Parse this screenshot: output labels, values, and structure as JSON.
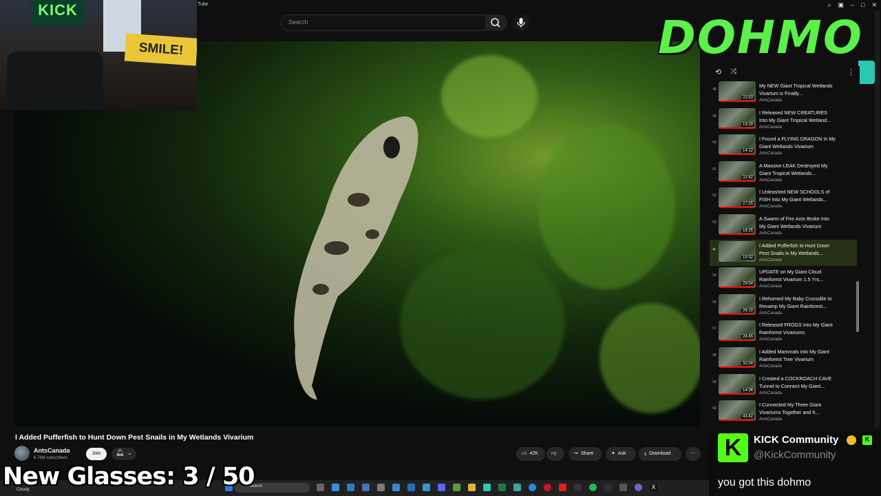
{
  "browser": {
    "tab_title": "Tube",
    "window_controls": [
      "zoom-icon",
      "screenshot-icon",
      "minimize-icon",
      "maximize-icon",
      "close-icon"
    ]
  },
  "search": {
    "placeholder": "Search"
  },
  "webcam_overlay": {
    "sign_kick": "KICK",
    "sign_smile": "SMILE!"
  },
  "logo": {
    "text": "DOHMO"
  },
  "playlist": {
    "items": [
      {
        "num": "48",
        "title": "My NEW Giant Tropical Wetlands Vivarium is Finally...",
        "channel": "AntsCanada",
        "duration": "22:53",
        "progress": 1.0,
        "current": false
      },
      {
        "num": "49",
        "title": "I Released NEW CREATURES Into My Giant Tropical Wetland...",
        "channel": "AntsCanada",
        "duration": "19:29",
        "progress": 1.0,
        "current": false
      },
      {
        "num": "50",
        "title": "I Found a FLYING DRAGON In My Giant Wetlands Vivarium",
        "channel": "AntsCanada",
        "duration": "14:12",
        "progress": 1.0,
        "current": false
      },
      {
        "num": "51",
        "title": "A Massive LEAK Destroyed My Giant Tropical Wetlands...",
        "channel": "AntsCanada",
        "duration": "22:42",
        "progress": 1.0,
        "current": false
      },
      {
        "num": "52",
        "title": "I Unleashed NEW SCHOOLS of FISH Into My Giant Wetlands...",
        "channel": "AntsCanada",
        "duration": "27:25",
        "progress": 1.0,
        "current": false
      },
      {
        "num": "53",
        "title": "A Swarm of Fire Ants Broke Into My Giant Wetlands Vivarium",
        "channel": "AntsCanada",
        "duration": "18:25",
        "progress": 1.0,
        "current": false
      },
      {
        "num": "▶",
        "title": "I Added Pufferfish to Hunt Down Pest Snails in My Wetlands...",
        "channel": "AntsCanada",
        "duration": "19:32",
        "progress": 0.0,
        "current": true
      },
      {
        "num": "55",
        "title": "UPDATE on My Giant Cloud Rainforest Vivarium 1.5 Yrs...",
        "channel": "AntsCanada",
        "duration": "29:54",
        "progress": 1.0,
        "current": false
      },
      {
        "num": "56",
        "title": "I Rehomed My Baby Crocodile to Revamp My Giant Rainforest...",
        "channel": "AntsCanada",
        "duration": "26:19",
        "progress": 1.0,
        "current": false
      },
      {
        "num": "57",
        "title": "I Released FROGS Into My Giant Rainforest Vivariums",
        "channel": "AntsCanada",
        "duration": "28:45",
        "progress": 1.0,
        "current": false
      },
      {
        "num": "58",
        "title": "I Added Mammals into My Giant Rainforest Tree Vivarium",
        "channel": "AntsCanada",
        "duration": "32:04",
        "progress": 1.0,
        "current": false
      },
      {
        "num": "59",
        "title": "I Created a COCKROACH CAVE Tunnel to Connect My Giant...",
        "channel": "AntsCanada",
        "duration": "14:06",
        "progress": 1.0,
        "current": false
      },
      {
        "num": "60",
        "title": "I Connected My Three Giant Vivariums Together and It...",
        "channel": "AntsCanada",
        "duration": "43:42",
        "progress": 1.0,
        "current": false
      }
    ]
  },
  "video": {
    "title": "I Added Pufferfish to Hunt Down Pest Snails in My Wetlands Vivarium",
    "channel": "AntsCanada",
    "subscribers": "6.76M subscribers",
    "join_label": "Join",
    "likes": "42K",
    "share_label": "Share",
    "ask_label": "Ask",
    "download_label": "Download"
  },
  "overlay_counter": {
    "text": "New Glasses:  3 / 50"
  },
  "taskbar": {
    "weather": "Cloudy",
    "search_label": "Search"
  },
  "chat": {
    "name": "KICK Community",
    "handle": "@KickCommunity",
    "message": "you got this dohmo",
    "logo_letter": "K"
  },
  "colors": {
    "kick_green": "#53fc18",
    "logo_green": "#5cf04a",
    "progress_red": "#ff0000",
    "playlist_accent": "#2bc7b0"
  }
}
